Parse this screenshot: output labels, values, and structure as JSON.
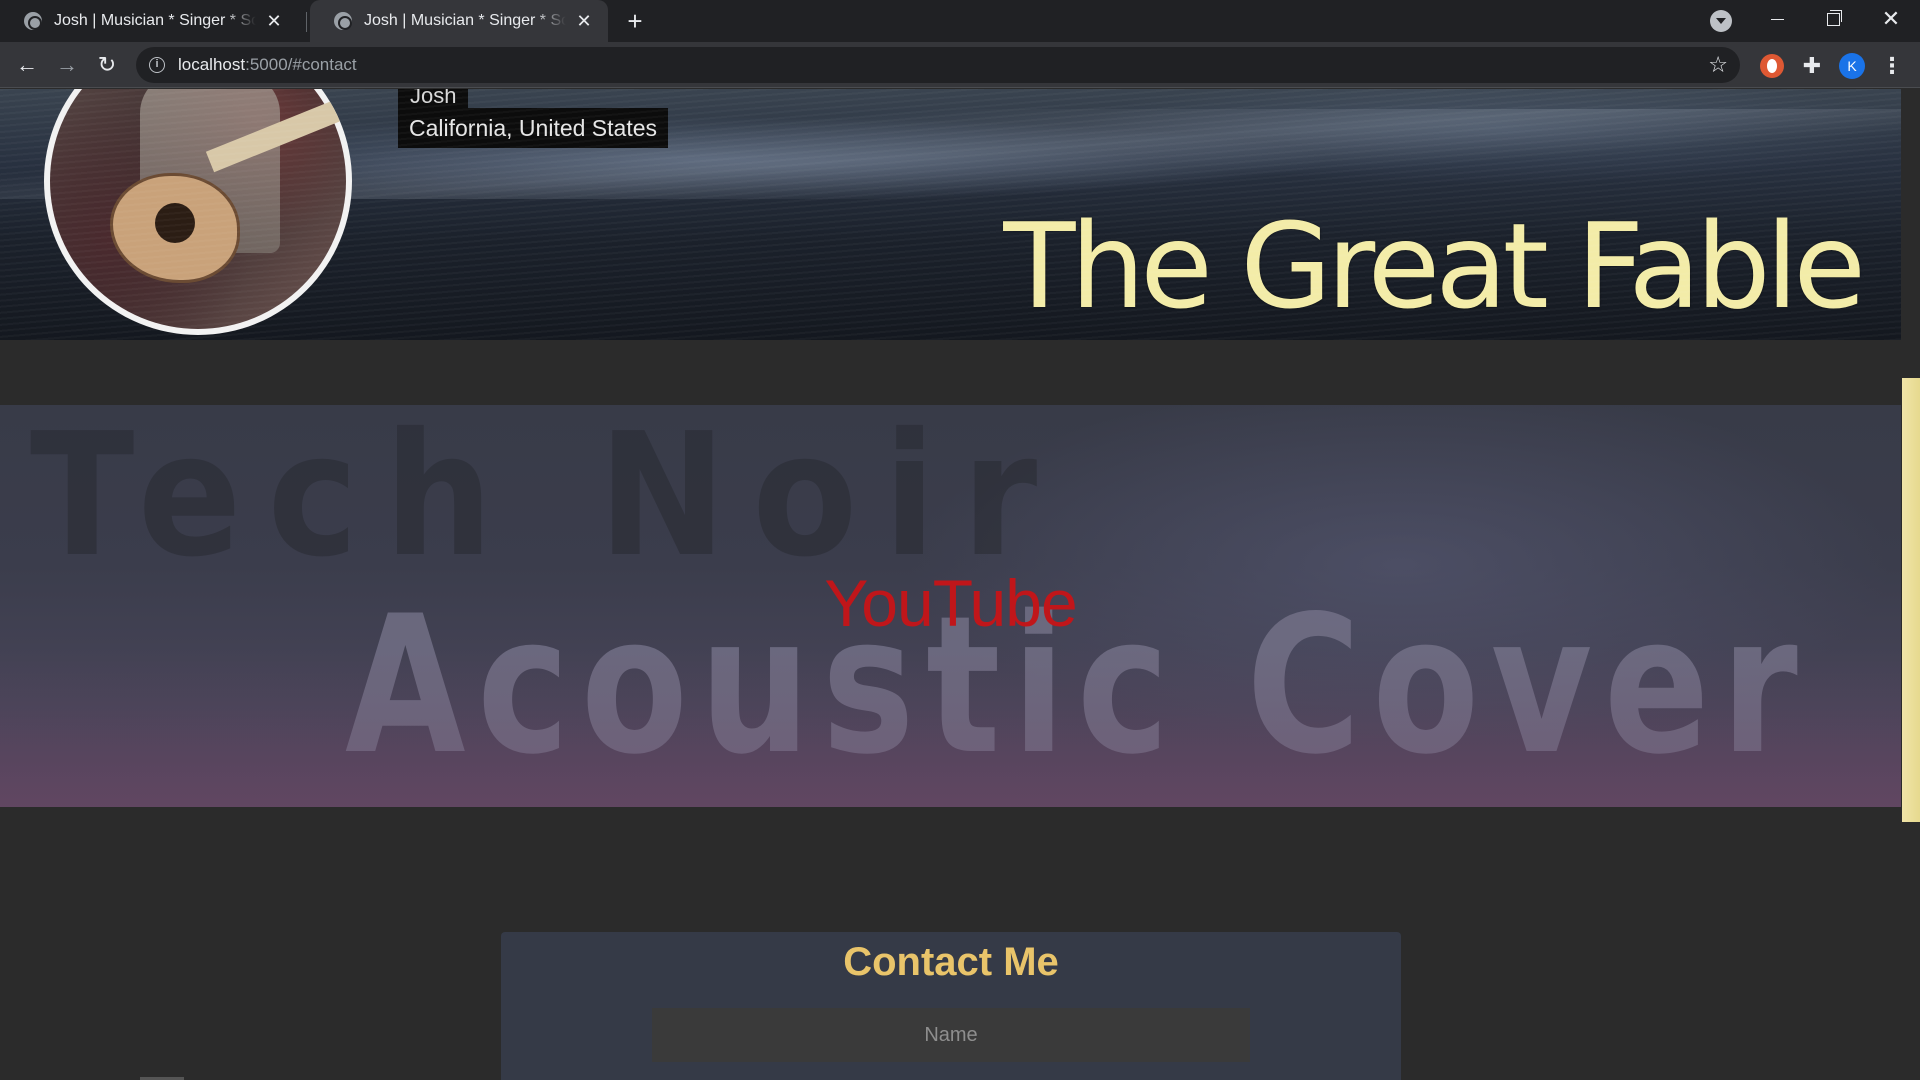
{
  "browser": {
    "tabs": [
      {
        "title": "Josh | Musician * Singer * Songwriter",
        "active": false
      },
      {
        "title": "Josh | Musician * Singer * Songwriter",
        "active": true
      }
    ],
    "new_tab_symbol": "+",
    "url_host": "localhost",
    "url_path": ":5000/#contact",
    "profile_initial": "K",
    "icons": [
      "globe-icon",
      "close-icon",
      "plus-icon",
      "tab-search-icon",
      "minimize-icon",
      "maximize-icon",
      "window-close-icon",
      "back-arrow-icon",
      "forward-arrow-icon",
      "reload-icon",
      "info-icon",
      "star-icon",
      "duckduckgo-icon",
      "puzzle-icon",
      "kebab-menu-icon"
    ]
  },
  "profile": {
    "name": "Josh",
    "location": "California, United States",
    "band_name": "The Great Fable"
  },
  "youtube": {
    "link_label": "YouTube",
    "thumbnail_line1": "Tech Noir",
    "thumbnail_line2": "Acoustic Cover",
    "link_color": "#c0161a"
  },
  "contact": {
    "heading": "Contact Me",
    "name_placeholder": "Name",
    "heading_color": "#e9c46a"
  }
}
